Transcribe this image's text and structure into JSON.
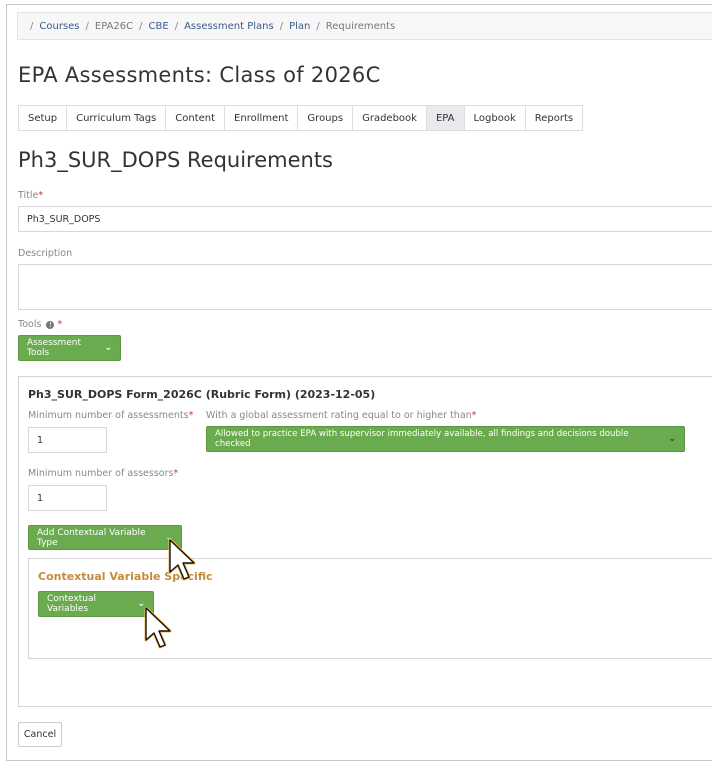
{
  "breadcrumb": {
    "items": [
      "Courses",
      "EPA26C",
      "CBE",
      "Assessment Plans",
      "Plan"
    ],
    "current": "Requirements"
  },
  "page_title": "EPA Assessments: Class of 2026C",
  "tabs": [
    {
      "label": "Setup"
    },
    {
      "label": "Curriculum Tags"
    },
    {
      "label": "Content"
    },
    {
      "label": "Enrollment"
    },
    {
      "label": "Groups"
    },
    {
      "label": "Gradebook"
    },
    {
      "label": "EPA",
      "active": true
    },
    {
      "label": "Logbook"
    },
    {
      "label": "Reports"
    }
  ],
  "section_title": "Ph3_SUR_DOPS Requirements",
  "form": {
    "title_label": "Title",
    "title_value": "Ph3_SUR_DOPS",
    "description_label": "Description",
    "description_value": "",
    "tools_label": "Tools",
    "tools_button": "Assessment Tools"
  },
  "panel": {
    "title": "Ph3_SUR_DOPS Form_2026C (Rubric Form) (2023-12-05)",
    "min_assessments_label": "Minimum number of assessments",
    "min_assessments_value": "1",
    "global_rating_label": "With a global assessment rating equal to or higher than",
    "global_rating_value": "Allowed to practice EPA with supervisor immediately available, all findings and decisions double checked",
    "min_assessors_label": "Minimum number of assessors",
    "min_assessors_value": "1",
    "add_ctx_button": "Add Contextual Variable Type",
    "ctx_title": "Contextual Variable Specific",
    "ctx_button": "Contextual Variables"
  },
  "cancel_label": "Cancel",
  "colors": {
    "accent_green": "#6bab4f",
    "ctx_title": "#c58a3e",
    "required": "#c0392b"
  }
}
